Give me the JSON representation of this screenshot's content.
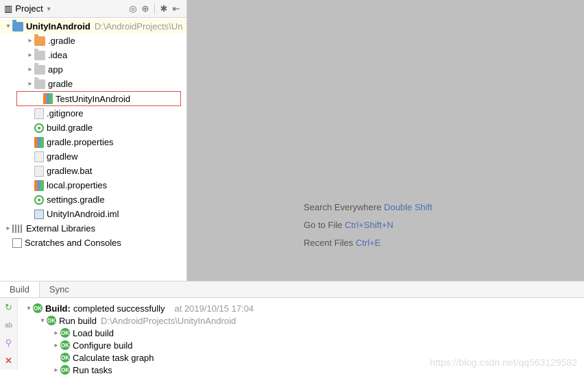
{
  "sidebar": {
    "title": "Project",
    "root": {
      "name": "UnityInAndroid",
      "path": "D:\\AndroidProjects\\Un"
    },
    "items": [
      {
        "label": ".gradle"
      },
      {
        "label": ".idea"
      },
      {
        "label": "app"
      },
      {
        "label": "gradle"
      },
      {
        "label": "TestUnityInAndroid"
      },
      {
        "label": ".gitignore"
      },
      {
        "label": "build.gradle"
      },
      {
        "label": "gradle.properties"
      },
      {
        "label": "gradlew"
      },
      {
        "label": "gradlew.bat"
      },
      {
        "label": "local.properties"
      },
      {
        "label": "settings.gradle"
      },
      {
        "label": "UnityInAndroid.iml"
      }
    ],
    "external": "External Libraries",
    "scratches": "Scratches and Consoles"
  },
  "main": {
    "hint1": "Search Everywhere",
    "hint1k": "Double Shift",
    "hint2": "Go to File",
    "hint2k": "Ctrl+Shift+N",
    "hint3": "Recent Files",
    "hint3k": "Ctrl+E"
  },
  "tabs": {
    "build": "Build",
    "sync": "Sync"
  },
  "build": {
    "title_prefix": "Build:",
    "title_status": "completed successfully",
    "title_time": "at 2019/10/15 17:04",
    "run": "Run build",
    "run_path": "D:\\AndroidProjects\\UnityInAndroid",
    "load": "Load build",
    "configure": "Configure build",
    "calc": "Calculate task graph",
    "tasks": "Run tasks"
  },
  "watermark": "https://blog.csdn.net/qq563129582"
}
